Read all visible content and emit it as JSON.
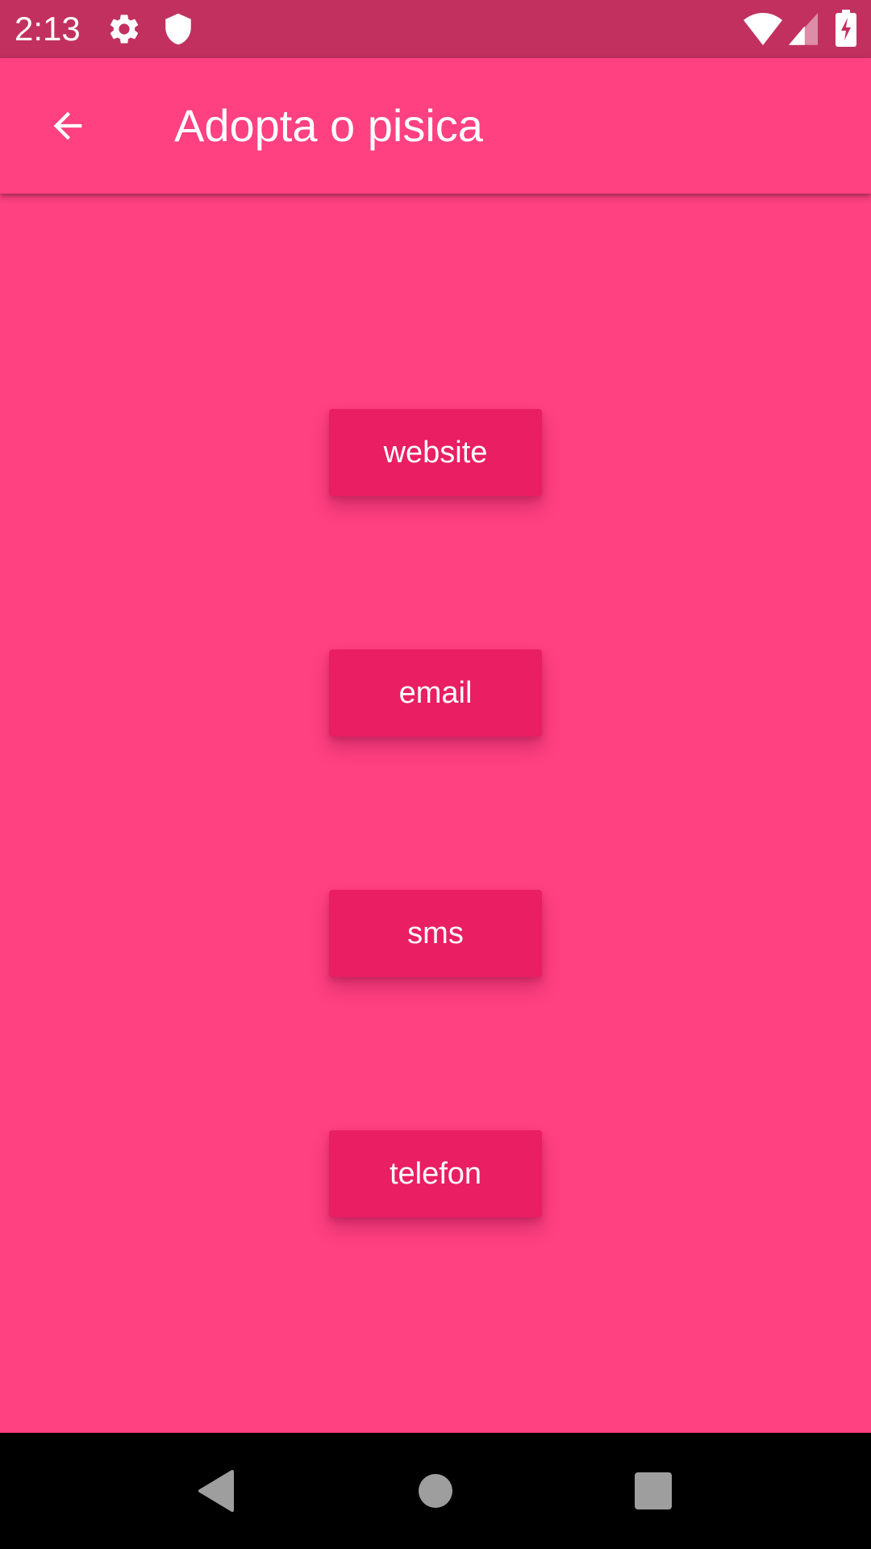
{
  "status_bar": {
    "time": "2:13",
    "icons": [
      "gear-icon",
      "shield-icon",
      "wifi-icon",
      "signal-icon",
      "battery-charging-icon"
    ]
  },
  "app_bar": {
    "title": "Adopta o pisica",
    "back_icon": "arrow-back-icon"
  },
  "buttons": [
    {
      "label": "website"
    },
    {
      "label": "email"
    },
    {
      "label": "sms"
    },
    {
      "label": "telefon"
    }
  ],
  "nav_bar": {
    "icons": [
      "back-triangle-icon",
      "home-circle-icon",
      "recents-square-icon"
    ]
  },
  "colors": {
    "status_bar": "#C2305F",
    "background": "#FF4081",
    "button": "#E91E63",
    "nav_bar": "#000000"
  }
}
